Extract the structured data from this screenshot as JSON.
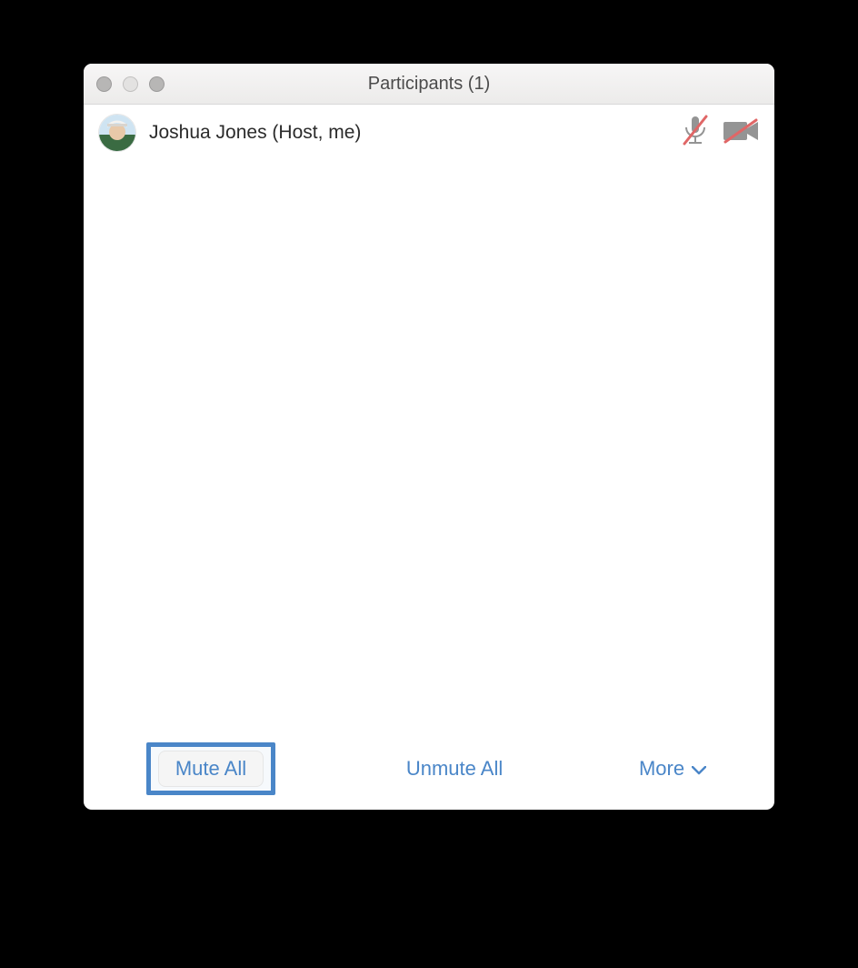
{
  "window": {
    "title": "Participants (1)"
  },
  "participants": [
    {
      "name": "Joshua Jones (Host, me)",
      "mic_muted": true,
      "video_off": true
    }
  ],
  "footer": {
    "mute_all": "Mute All",
    "unmute_all": "Unmute All",
    "more": "More"
  },
  "colors": {
    "accent": "#4a86c8",
    "mute_slash": "#e06666",
    "icon_gray": "#949494"
  }
}
